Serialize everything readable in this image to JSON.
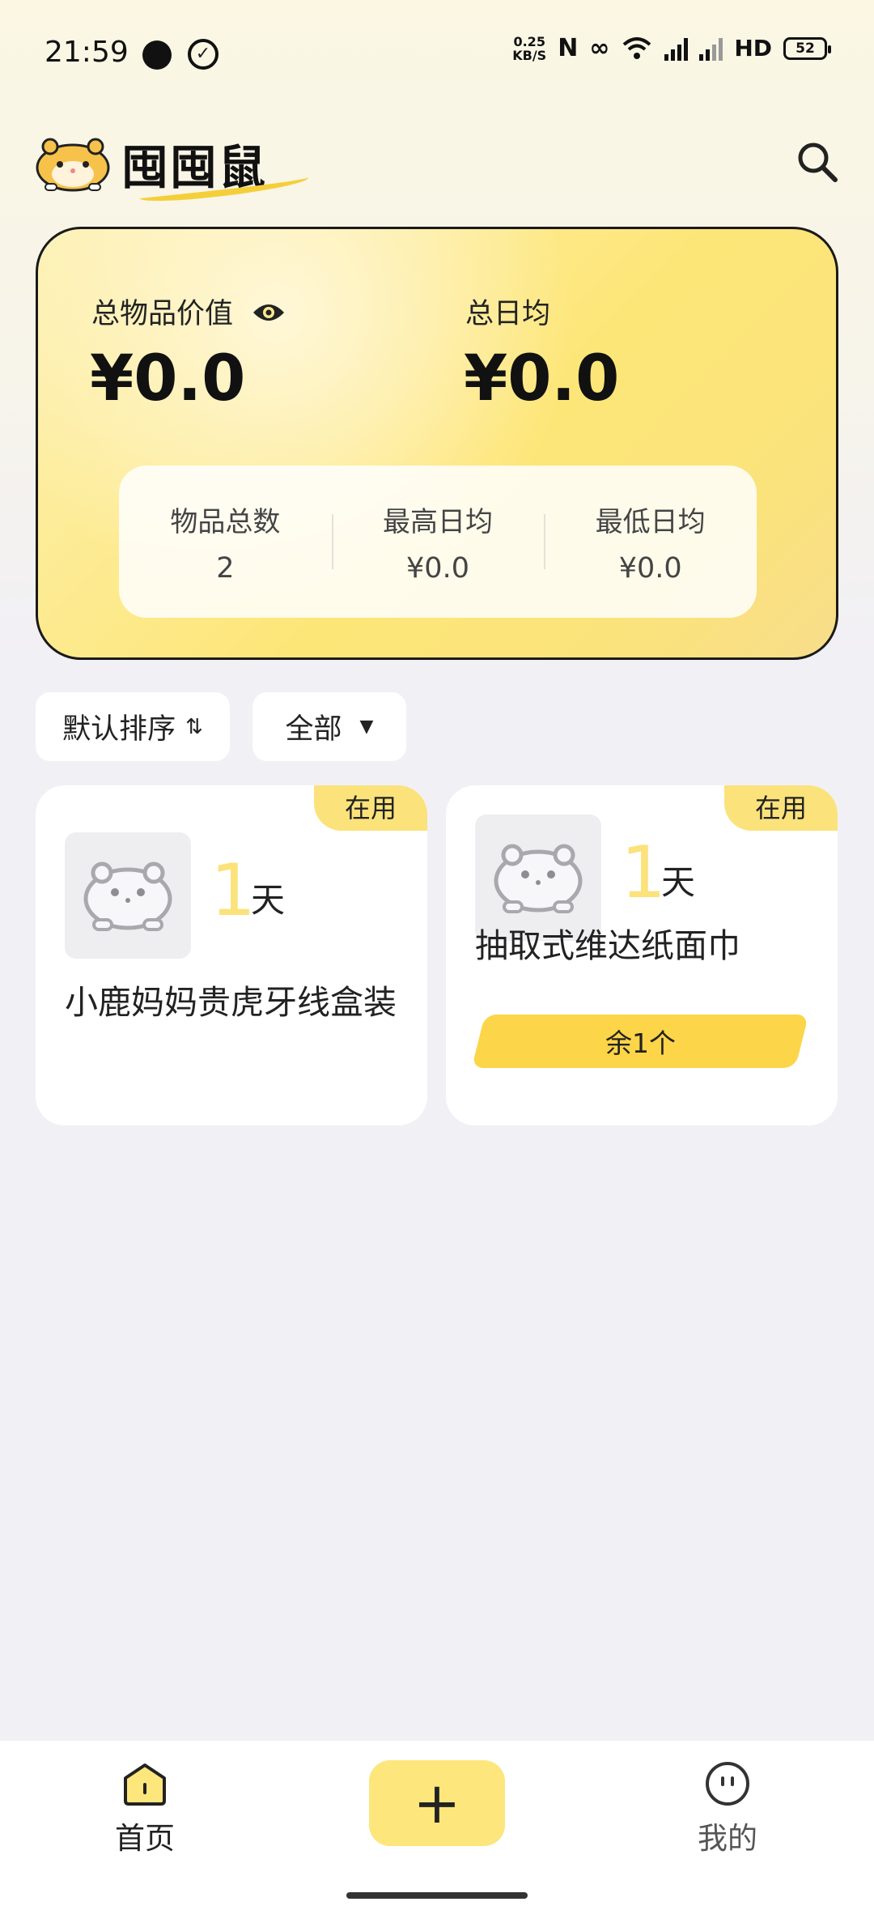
{
  "status_bar": {
    "time": "21:59",
    "net_speed_value": "0.25",
    "net_speed_unit": "KB/S",
    "hd_label": "HD",
    "battery": "52"
  },
  "header": {
    "app_name": "囤囤鼠",
    "logo_icon": "hamster-icon",
    "search_icon": "search-icon"
  },
  "summary": {
    "total_value_label": "总物品价值",
    "total_value": "¥0.0",
    "daily_avg_label": "总日均",
    "daily_avg": "¥0.0",
    "stats": [
      {
        "label": "物品总数",
        "value": "2"
      },
      {
        "label": "最高日均",
        "value": "¥0.0"
      },
      {
        "label": "最低日均",
        "value": "¥0.0"
      }
    ]
  },
  "filters": {
    "sort_label": "默认排序",
    "category_label": "全部"
  },
  "items": [
    {
      "badge": "在用",
      "days": "1",
      "days_unit": "天",
      "title": "小鹿妈妈贵虎牙线盒装",
      "remaining": ""
    },
    {
      "badge": "在用",
      "days": "1",
      "days_unit": "天",
      "title": "抽取式维达纸面巾",
      "remaining": "余1个"
    }
  ],
  "nav": {
    "home_label": "首页",
    "add_label": "+",
    "mine_label": "我的"
  },
  "colors": {
    "accent_yellow": "#fde67c",
    "badge_yellow": "#fbe27a",
    "remaining_yellow": "#fcd548",
    "background": "#f1f0f5"
  }
}
